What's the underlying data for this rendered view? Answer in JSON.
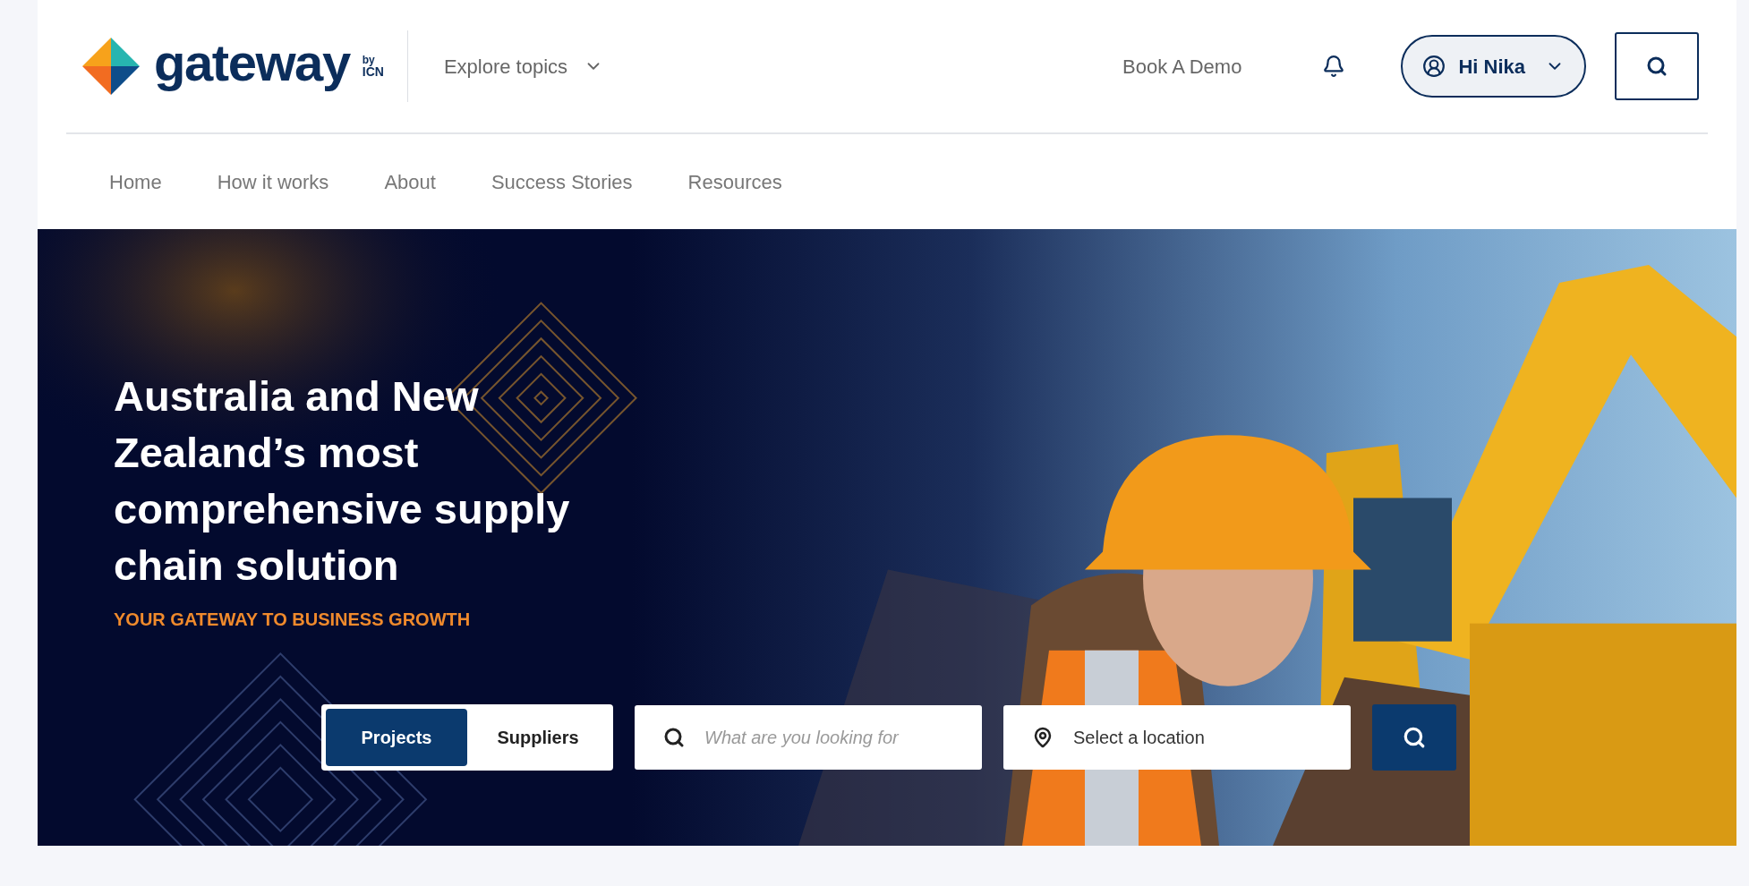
{
  "logo": {
    "name": "gateway",
    "by": "by",
    "org": "ICN"
  },
  "header": {
    "explore": "Explore topics",
    "demo": "Book A Demo",
    "user": "Hi Nika"
  },
  "nav": [
    {
      "label": "Home"
    },
    {
      "label": "How it works"
    },
    {
      "label": "About"
    },
    {
      "label": "Success Stories"
    },
    {
      "label": "Resources"
    }
  ],
  "hero": {
    "heading": "Australia and New Zealand’s most comprehensive supply chain solution",
    "tagline": "YOUR GATEWAY TO BUSINESS GROWTH"
  },
  "search": {
    "modes": [
      {
        "label": "Projects",
        "selected": true
      },
      {
        "label": "Suppliers",
        "selected": false
      }
    ],
    "query": {
      "placeholder": "What are you looking for"
    },
    "location": {
      "placeholder": "Select a location"
    }
  }
}
